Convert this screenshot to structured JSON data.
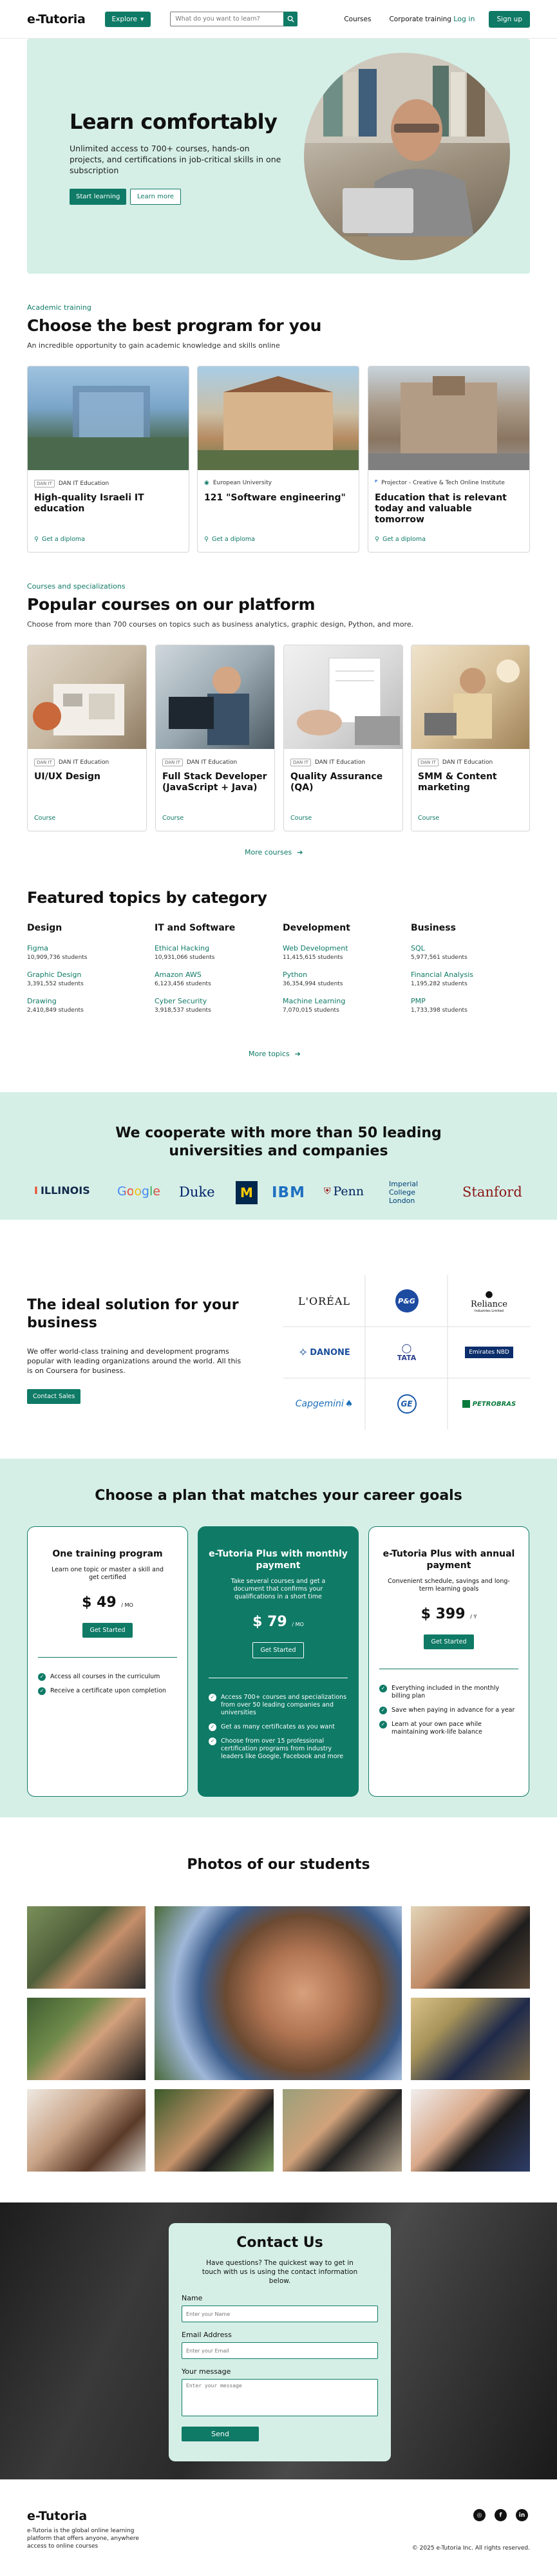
{
  "header": {
    "logo": "e-Tutoria",
    "explore_label": "Explore",
    "search_placeholder": "What do you want to learn?",
    "nav": [
      "Courses",
      "Corporate training"
    ],
    "login": "Log in",
    "signup": "Sign up"
  },
  "hero": {
    "title": "Learn comfortably",
    "description": "Unlimited access to 700+ courses, hands-on projects, and certifications in job-critical skills in one subscription",
    "primary_button": "Start learning",
    "secondary_button": "Learn more"
  },
  "academic": {
    "eyebrow": "Academic training",
    "title": "Choose the best program for you",
    "subtitle": "An incredible opportunity to gain academic knowledge and skills online",
    "cards": [
      {
        "org": "DAN IT Education",
        "title": "High-quality Israeli IT education",
        "link": "Get a diploma"
      },
      {
        "org": "European University",
        "title": "121 \"Software engineering\"",
        "link": "Get a diploma"
      },
      {
        "org": "Projector - Creative & Tech Online Institute",
        "title": "Education that is relevant today and valuable tomorrow",
        "link": "Get a diploma"
      }
    ]
  },
  "popular": {
    "eyebrow": "Courses and specializations",
    "title": "Popular courses on our platform",
    "subtitle": "Choose from more than 700 courses on topics such as business analytics, graphic design, Python, and more.",
    "cards": [
      {
        "org": "DAN IT Education",
        "title": "UI/UX Design",
        "tag": "Course"
      },
      {
        "org": "DAN IT Education",
        "title": "Full Stack Developer (JavaScript + Java)",
        "tag": "Course"
      },
      {
        "org": "DAN IT Education",
        "title": "Quality Assurance (QA)",
        "tag": "Course"
      },
      {
        "org": "DAN IT Education",
        "title": "SMM & Content marketing",
        "tag": "Course"
      }
    ],
    "more": "More courses"
  },
  "topics": {
    "title": "Featured topics by category",
    "columns": [
      {
        "heading": "Design",
        "items": [
          {
            "name": "Figma",
            "students": "10,909,736 students"
          },
          {
            "name": "Graphic Design",
            "students": "3,391,552 students"
          },
          {
            "name": "Drawing",
            "students": "2,410,849 students"
          }
        ]
      },
      {
        "heading": "IT and Software",
        "items": [
          {
            "name": "Ethical Hacking",
            "students": "10,931,066 students"
          },
          {
            "name": "Amazon AWS",
            "students": "6,123,456 students"
          },
          {
            "name": "Cyber Security",
            "students": "3,918,537 students"
          }
        ]
      },
      {
        "heading": "Development",
        "items": [
          {
            "name": "Web Development",
            "students": "11,415,615 students"
          },
          {
            "name": "Python",
            "students": "36,354,994 students"
          },
          {
            "name": "Machine Learning",
            "students": "7,070,015 students"
          }
        ]
      },
      {
        "heading": "Business",
        "items": [
          {
            "name": "SQL",
            "students": "5,977,561 students"
          },
          {
            "name": "Financial Analysis",
            "students": "1,195,282 students"
          },
          {
            "name": "PMP",
            "students": "1,733,398 students"
          }
        ]
      }
    ],
    "more": "More topics"
  },
  "partners": {
    "title_line1": "We cooperate with more than 50 leading",
    "title_line2": "universities and companies",
    "logos": [
      "ILLINOIS",
      "Google",
      "Duke",
      "M",
      "IBM",
      "Penn",
      "Imperial College London",
      "Stanford"
    ]
  },
  "ideal": {
    "title": "The ideal solution for your business",
    "description": "We offer world-class training and development programs popular with leading organizations around the world. All this is on Coursera for business.",
    "button": "Contact Sales",
    "logos": [
      "L'ORÉAL",
      "P&G",
      "Reliance",
      "DANONE",
      "TATA",
      "Emirates NBD",
      "Capgemini",
      "GE",
      "PETROBRAS"
    ],
    "reliance_sub": "Industries Limited"
  },
  "plans": {
    "title": "Choose a plan that matches your career goals",
    "items": [
      {
        "name": "One training program",
        "desc": "Learn one topic or master a skill and get certified",
        "price": "$ 49",
        "per": "/ MO",
        "button": "Get Started",
        "features": [
          "Access all courses in the curriculum",
          "Receive a certificate upon completion"
        ]
      },
      {
        "name": "e-Tutoria Plus with monthly payment",
        "desc": "Take several courses and get a document that confirms your qualifications in a short time",
        "price": "$ 79",
        "per": "/ MO",
        "button": "Get Started",
        "features": [
          "Access 700+ courses and specializations from over 50 leading companies and universities",
          "Get as many certificates as you want",
          "Choose from over 15 professional certification programs from industry leaders like Google, Facebook and more"
        ]
      },
      {
        "name": "e-Tutoria Plus with annual payment",
        "desc": "Convenient schedule, savings and long-term learning goals",
        "price": "$ 399",
        "per": "/ Y",
        "button": "Get Started",
        "features": [
          "Everything included in the monthly billing plan",
          "Save when paying in advance for a year",
          "Learn at your own pace while maintaining work-life balance"
        ]
      }
    ]
  },
  "photos": {
    "title": "Photos of our students"
  },
  "contact": {
    "title": "Contact Us",
    "description": "Have questions? The quickest way to get in touch with us is using the contact information below.",
    "name_label": "Name",
    "name_placeholder": "Enter your Name",
    "email_label": "Email Address",
    "email_placeholder": "Enter your Email",
    "message_label": "Your message",
    "message_placeholder": "Enter your message",
    "send": "Send"
  },
  "footer": {
    "logo": "e-Tutoria",
    "description": "e-Tutoria is the global online learning platform that offers anyone, anywhere access to online courses",
    "copyright": "© 2025 e-Tutoria Inc. All rights reserved.",
    "social": [
      "instagram-icon",
      "facebook-icon",
      "linkedin-icon"
    ]
  },
  "colors": {
    "accent": "#0f7a66",
    "mint": "#d5efe7"
  }
}
